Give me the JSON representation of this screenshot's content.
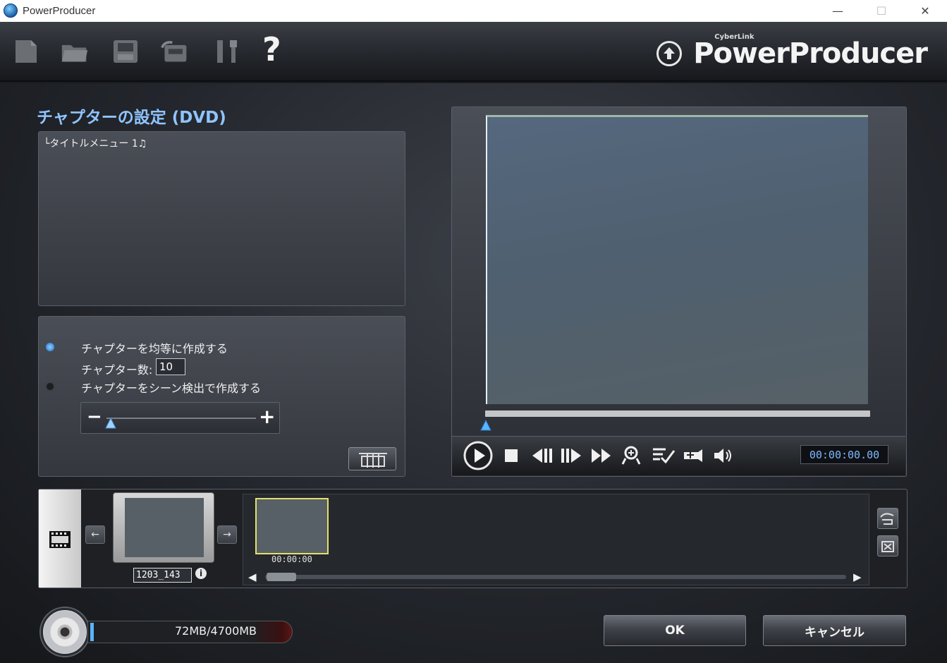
{
  "window": {
    "title": "PowerProducer",
    "controls": {
      "minimize": "—",
      "maximize": "☐",
      "close": "✕"
    }
  },
  "toolbar": {
    "icons": [
      "new-file-icon",
      "open-folder-icon",
      "save-icon",
      "export-icon",
      "tools-icon",
      "help-icon"
    ],
    "help_glyph": "?",
    "brand": {
      "vendor": "CyberLink",
      "product": "PowerProducer"
    }
  },
  "chapter_settings": {
    "title": "チャプターの設定 (DVD)",
    "tree_item": "└タイトルメニュー 1♫",
    "options": {
      "even_label": "チャプターを均等に作成する",
      "count_label": "チャプター数:",
      "count_value": "10",
      "scene_label": "チャプターをシーン検出で作成する",
      "selected": "even"
    },
    "slider": {
      "minus": "−",
      "plus": "+",
      "level": 0.1
    }
  },
  "player": {
    "timecode": "00:00:00.00",
    "position": 0,
    "controls": [
      "play-icon",
      "stop-icon",
      "prev-frame-icon",
      "next-frame-icon",
      "fast-forward-icon",
      "add-chapter-icon",
      "chapter-list-icon",
      "snapshot-icon",
      "volume-icon"
    ]
  },
  "timeline": {
    "title_name": "1203_143",
    "info": "i",
    "chapters": [
      {
        "time": "00:00:00"
      }
    ],
    "scroll_left": "◀",
    "scroll_right": "▶",
    "nav_left": "←",
    "nav_right": "→"
  },
  "footer": {
    "capacity": "72MB/4700MB",
    "capacity_fraction": 0.0153,
    "ok_label": "OK",
    "cancel_label": "キャンセル"
  },
  "colors": {
    "accent": "#8fc4ff",
    "timecode": "#7fb8ff",
    "chapter_highlight": "#e6e06a"
  }
}
